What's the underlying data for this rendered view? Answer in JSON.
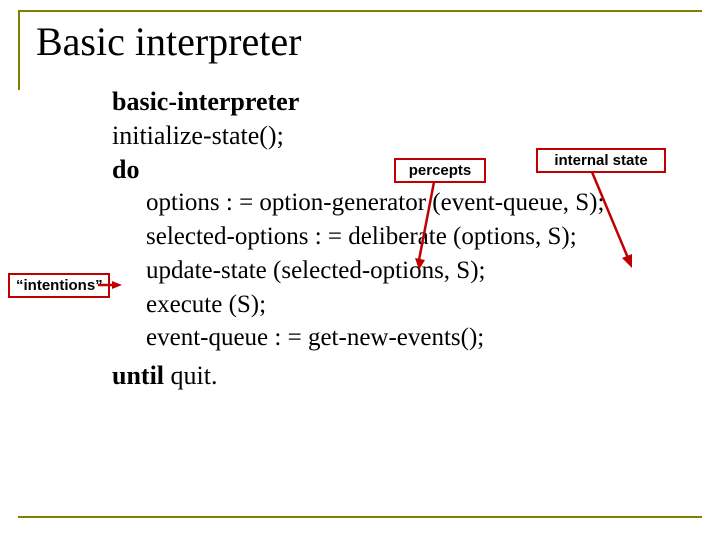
{
  "title": "Basic interpreter",
  "code": {
    "header1": "basic-interpreter",
    "header2": "initialize-state();",
    "header3": "do",
    "line1": "options : = option-generator (event-queue, S);",
    "line2": "selected-options : = deliberate (options, S);",
    "line3": "update-state (selected-options, S);",
    "line4": "execute (S);",
    "line5": "event-queue : = get-new-events();",
    "footer_kw": "until",
    "footer_rest": " quit."
  },
  "annotations": {
    "percepts": "percepts",
    "internal_state": "internal state",
    "intentions": "“intentions”"
  }
}
